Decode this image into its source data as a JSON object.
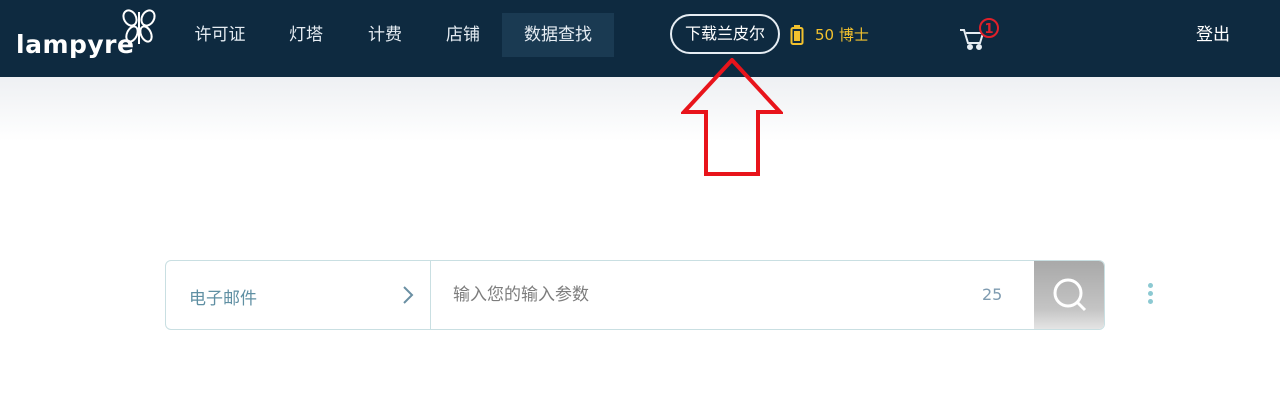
{
  "brand": {
    "name": "lampyre",
    "logo_icon": "firefly-logo-icon"
  },
  "nav": {
    "items": [
      {
        "label": "许可证"
      },
      {
        "label": "灯塔"
      },
      {
        "label": "计费"
      },
      {
        "label": "店铺"
      },
      {
        "label": "数据查找",
        "active": true
      }
    ],
    "download_label": "下载兰皮尔",
    "credits": {
      "icon": "battery-icon",
      "label": "50 博士"
    },
    "cart": {
      "icon": "cart-icon",
      "badge": "1"
    },
    "logout_label": "登出"
  },
  "annotation": {
    "icon": "red-up-arrow-icon",
    "color": "#e8141b"
  },
  "search": {
    "type_label": "电子邮件",
    "type_icon": "chevron-right-icon",
    "placeholder": "输入您的输入参数",
    "value": "",
    "counter": "25",
    "button_icon": "search-icon",
    "menu_icon": "kebab-menu-icon"
  },
  "colors": {
    "navbar": "#0e2a40",
    "accent_gold": "#f2c12e",
    "badge_red": "#e0202a",
    "input_border": "#c9dfe2"
  }
}
